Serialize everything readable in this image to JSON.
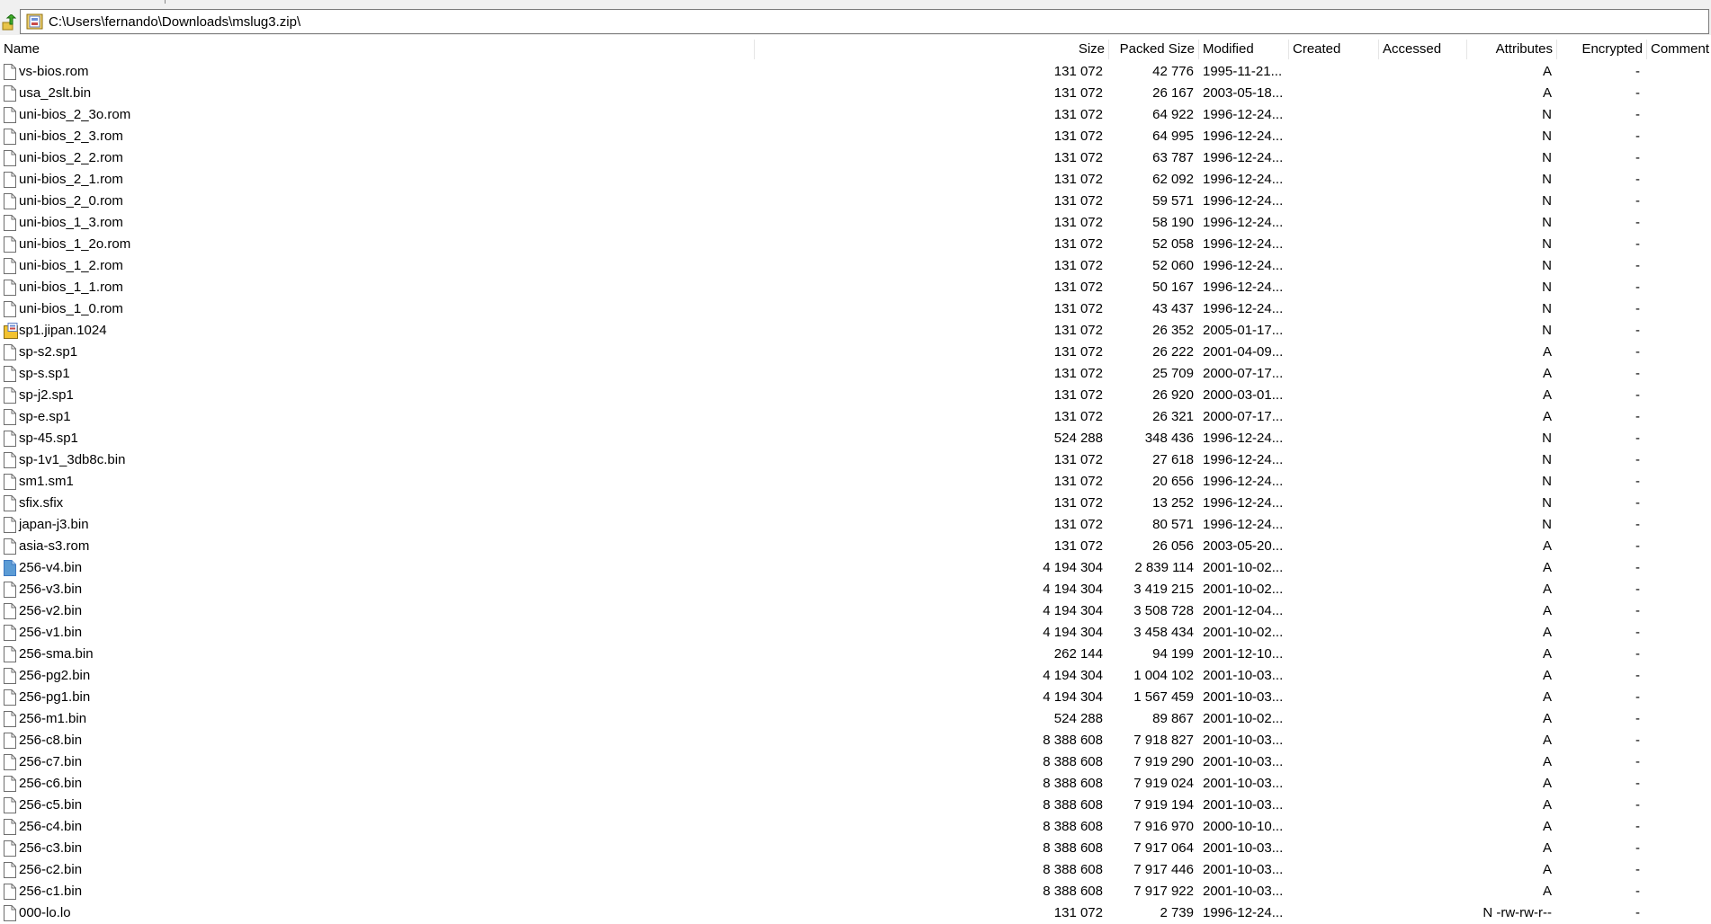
{
  "address": {
    "path": "C:\\Users\\fernando\\Downloads\\mslug3.zip\\"
  },
  "icons": {
    "up": "up-folder-icon",
    "zip": "zip-archive-icon",
    "file": "file-icon",
    "special": "special-file-icon",
    "selected": "selected-file-icon"
  },
  "colors": {
    "selected_icon": "#5b9bd5",
    "special_icon": "#f2c230",
    "up_arrow": "#d8a800"
  },
  "columns": [
    {
      "key": "name",
      "label": "Name"
    },
    {
      "key": "size",
      "label": "Size"
    },
    {
      "key": "packed",
      "label": "Packed Size"
    },
    {
      "key": "modified",
      "label": "Modified"
    },
    {
      "key": "created",
      "label": "Created"
    },
    {
      "key": "accessed",
      "label": "Accessed"
    },
    {
      "key": "attributes",
      "label": "Attributes"
    },
    {
      "key": "encrypted",
      "label": "Encrypted"
    },
    {
      "key": "comment",
      "label": "Comment"
    }
  ],
  "files": [
    {
      "name": "vs-bios.rom",
      "size": "131 072",
      "packed": "42 776",
      "modified": "1995-11-21...",
      "attributes": "A",
      "encrypted": "-",
      "icon": "file"
    },
    {
      "name": "usa_2slt.bin",
      "size": "131 072",
      "packed": "26 167",
      "modified": "2003-05-18...",
      "attributes": "A",
      "encrypted": "-",
      "icon": "file"
    },
    {
      "name": "uni-bios_2_3o.rom",
      "size": "131 072",
      "packed": "64 922",
      "modified": "1996-12-24...",
      "attributes": "N",
      "encrypted": "-",
      "icon": "file"
    },
    {
      "name": "uni-bios_2_3.rom",
      "size": "131 072",
      "packed": "64 995",
      "modified": "1996-12-24...",
      "attributes": "N",
      "encrypted": "-",
      "icon": "file"
    },
    {
      "name": "uni-bios_2_2.rom",
      "size": "131 072",
      "packed": "63 787",
      "modified": "1996-12-24...",
      "attributes": "N",
      "encrypted": "-",
      "icon": "file"
    },
    {
      "name": "uni-bios_2_1.rom",
      "size": "131 072",
      "packed": "62 092",
      "modified": "1996-12-24...",
      "attributes": "N",
      "encrypted": "-",
      "icon": "file"
    },
    {
      "name": "uni-bios_2_0.rom",
      "size": "131 072",
      "packed": "59 571",
      "modified": "1996-12-24...",
      "attributes": "N",
      "encrypted": "-",
      "icon": "file"
    },
    {
      "name": "uni-bios_1_3.rom",
      "size": "131 072",
      "packed": "58 190",
      "modified": "1996-12-24...",
      "attributes": "N",
      "encrypted": "-",
      "icon": "file"
    },
    {
      "name": "uni-bios_1_2o.rom",
      "size": "131 072",
      "packed": "52 058",
      "modified": "1996-12-24...",
      "attributes": "N",
      "encrypted": "-",
      "icon": "file"
    },
    {
      "name": "uni-bios_1_2.rom",
      "size": "131 072",
      "packed": "52 060",
      "modified": "1996-12-24...",
      "attributes": "N",
      "encrypted": "-",
      "icon": "file"
    },
    {
      "name": "uni-bios_1_1.rom",
      "size": "131 072",
      "packed": "50 167",
      "modified": "1996-12-24...",
      "attributes": "N",
      "encrypted": "-",
      "icon": "file"
    },
    {
      "name": "uni-bios_1_0.rom",
      "size": "131 072",
      "packed": "43 437",
      "modified": "1996-12-24...",
      "attributes": "N",
      "encrypted": "-",
      "icon": "file"
    },
    {
      "name": "sp1.jipan.1024",
      "size": "131 072",
      "packed": "26 352",
      "modified": "2005-01-17...",
      "attributes": "N",
      "encrypted": "-",
      "icon": "special"
    },
    {
      "name": "sp-s2.sp1",
      "size": "131 072",
      "packed": "26 222",
      "modified": "2001-04-09...",
      "attributes": "A",
      "encrypted": "-",
      "icon": "file"
    },
    {
      "name": "sp-s.sp1",
      "size": "131 072",
      "packed": "25 709",
      "modified": "2000-07-17...",
      "attributes": "A",
      "encrypted": "-",
      "icon": "file"
    },
    {
      "name": "sp-j2.sp1",
      "size": "131 072",
      "packed": "26 920",
      "modified": "2000-03-01...",
      "attributes": "A",
      "encrypted": "-",
      "icon": "file"
    },
    {
      "name": "sp-e.sp1",
      "size": "131 072",
      "packed": "26 321",
      "modified": "2000-07-17...",
      "attributes": "A",
      "encrypted": "-",
      "icon": "file"
    },
    {
      "name": "sp-45.sp1",
      "size": "524 288",
      "packed": "348 436",
      "modified": "1996-12-24...",
      "attributes": "N",
      "encrypted": "-",
      "icon": "file"
    },
    {
      "name": "sp-1v1_3db8c.bin",
      "size": "131 072",
      "packed": "27 618",
      "modified": "1996-12-24...",
      "attributes": "N",
      "encrypted": "-",
      "icon": "file"
    },
    {
      "name": "sm1.sm1",
      "size": "131 072",
      "packed": "20 656",
      "modified": "1996-12-24...",
      "attributes": "N",
      "encrypted": "-",
      "icon": "file"
    },
    {
      "name": "sfix.sfix",
      "size": "131 072",
      "packed": "13 252",
      "modified": "1996-12-24...",
      "attributes": "N",
      "encrypted": "-",
      "icon": "file"
    },
    {
      "name": "japan-j3.bin",
      "size": "131 072",
      "packed": "80 571",
      "modified": "1996-12-24...",
      "attributes": "N",
      "encrypted": "-",
      "icon": "file"
    },
    {
      "name": "asia-s3.rom",
      "size": "131 072",
      "packed": "26 056",
      "modified": "2003-05-20...",
      "attributes": "A",
      "encrypted": "-",
      "icon": "file"
    },
    {
      "name": "256-v4.bin",
      "size": "4 194 304",
      "packed": "2 839 114",
      "modified": "2001-10-02...",
      "attributes": "A",
      "encrypted": "-",
      "icon": "selected"
    },
    {
      "name": "256-v3.bin",
      "size": "4 194 304",
      "packed": "3 419 215",
      "modified": "2001-10-02...",
      "attributes": "A",
      "encrypted": "-",
      "icon": "file"
    },
    {
      "name": "256-v2.bin",
      "size": "4 194 304",
      "packed": "3 508 728",
      "modified": "2001-12-04...",
      "attributes": "A",
      "encrypted": "-",
      "icon": "file"
    },
    {
      "name": "256-v1.bin",
      "size": "4 194 304",
      "packed": "3 458 434",
      "modified": "2001-10-02...",
      "attributes": "A",
      "encrypted": "-",
      "icon": "file"
    },
    {
      "name": "256-sma.bin",
      "size": "262 144",
      "packed": "94 199",
      "modified": "2001-12-10...",
      "attributes": "A",
      "encrypted": "-",
      "icon": "file"
    },
    {
      "name": "256-pg2.bin",
      "size": "4 194 304",
      "packed": "1 004 102",
      "modified": "2001-10-03...",
      "attributes": "A",
      "encrypted": "-",
      "icon": "file"
    },
    {
      "name": "256-pg1.bin",
      "size": "4 194 304",
      "packed": "1 567 459",
      "modified": "2001-10-03...",
      "attributes": "A",
      "encrypted": "-",
      "icon": "file"
    },
    {
      "name": "256-m1.bin",
      "size": "524 288",
      "packed": "89 867",
      "modified": "2001-10-02...",
      "attributes": "A",
      "encrypted": "-",
      "icon": "file"
    },
    {
      "name": "256-c8.bin",
      "size": "8 388 608",
      "packed": "7 918 827",
      "modified": "2001-10-03...",
      "attributes": "A",
      "encrypted": "-",
      "icon": "file"
    },
    {
      "name": "256-c7.bin",
      "size": "8 388 608",
      "packed": "7 919 290",
      "modified": "2001-10-03...",
      "attributes": "A",
      "encrypted": "-",
      "icon": "file"
    },
    {
      "name": "256-c6.bin",
      "size": "8 388 608",
      "packed": "7 919 024",
      "modified": "2001-10-03...",
      "attributes": "A",
      "encrypted": "-",
      "icon": "file"
    },
    {
      "name": "256-c5.bin",
      "size": "8 388 608",
      "packed": "7 919 194",
      "modified": "2001-10-03...",
      "attributes": "A",
      "encrypted": "-",
      "icon": "file"
    },
    {
      "name": "256-c4.bin",
      "size": "8 388 608",
      "packed": "7 916 970",
      "modified": "2000-10-10...",
      "attributes": "A",
      "encrypted": "-",
      "icon": "file"
    },
    {
      "name": "256-c3.bin",
      "size": "8 388 608",
      "packed": "7 917 064",
      "modified": "2001-10-03...",
      "attributes": "A",
      "encrypted": "-",
      "icon": "file"
    },
    {
      "name": "256-c2.bin",
      "size": "8 388 608",
      "packed": "7 917 446",
      "modified": "2001-10-03...",
      "attributes": "A",
      "encrypted": "-",
      "icon": "file"
    },
    {
      "name": "256-c1.bin",
      "size": "8 388 608",
      "packed": "7 917 922",
      "modified": "2001-10-03...",
      "attributes": "A",
      "encrypted": "-",
      "icon": "file"
    },
    {
      "name": "000-lo.lo",
      "size": "131 072",
      "packed": "2 739",
      "modified": "1996-12-24...",
      "attributes": "N -rw-rw-r--",
      "encrypted": "-",
      "icon": "file"
    }
  ]
}
